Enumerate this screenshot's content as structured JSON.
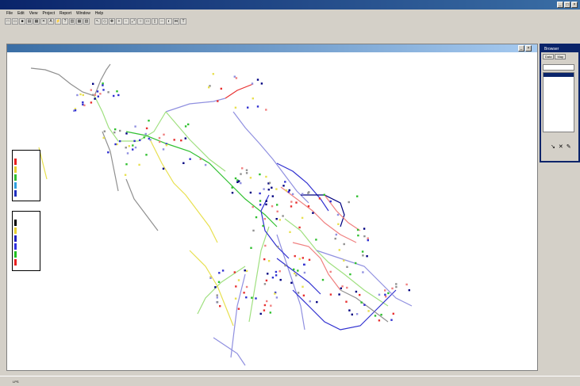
{
  "app": {
    "title": ""
  },
  "menu": {
    "items": [
      "File",
      "Edit",
      "View",
      "Project",
      "Report",
      "Window",
      "Help"
    ]
  },
  "toolbar": {
    "buttons": [
      {
        "name": "new",
        "glyph": "□"
      },
      {
        "name": "open",
        "glyph": "▭"
      },
      {
        "name": "save",
        "glyph": "■"
      },
      {
        "name": "print",
        "glyph": "▤"
      },
      {
        "name": "copy",
        "glyph": "▦"
      },
      {
        "name": "delete",
        "glyph": "✕"
      },
      {
        "name": "find",
        "glyph": "A"
      },
      {
        "name": "run",
        "glyph": "⚡"
      },
      {
        "name": "query",
        "glyph": "?"
      },
      {
        "name": "graph",
        "glyph": "▥"
      },
      {
        "name": "table",
        "glyph": "▦"
      },
      {
        "name": "options",
        "glyph": "▧"
      },
      {
        "name": "select",
        "glyph": "↖"
      },
      {
        "name": "vertex",
        "glyph": "◇"
      },
      {
        "name": "pan",
        "glyph": "✥"
      },
      {
        "name": "zoom-in",
        "glyph": "+"
      },
      {
        "name": "zoom-out",
        "glyph": "−"
      },
      {
        "name": "full-extent",
        "glyph": "⤢"
      },
      {
        "name": "junction",
        "glyph": "○"
      },
      {
        "name": "reservoir",
        "glyph": "▭"
      },
      {
        "name": "tank",
        "glyph": "▯"
      },
      {
        "name": "pipe",
        "glyph": "─"
      },
      {
        "name": "pump",
        "glyph": "◐"
      },
      {
        "name": "valve",
        "glyph": "⋈"
      },
      {
        "name": "label",
        "glyph": "T"
      }
    ]
  },
  "map": {
    "title": "",
    "colors": {
      "red": "#e83030",
      "pink": "#f08080",
      "green": "#30c030",
      "lightgreen": "#a0e080",
      "yellow": "#e8e050",
      "blue": "#3030d0",
      "lightblue": "#9090e0",
      "navy": "#000080",
      "grey": "#909090"
    }
  },
  "legend_nodes": {
    "title": "",
    "labels": [
      "",
      "",
      "",
      "",
      ""
    ],
    "colors": [
      "#e82020",
      "#e8d030",
      "#30c030",
      "#30a0e0",
      "#2030c0"
    ]
  },
  "legend_links": {
    "title": "",
    "labels": [
      "",
      "",
      "",
      "",
      "",
      ""
    ],
    "colors": [
      "#000000",
      "#e8d030",
      "#2020c0",
      "#3030e0",
      "#20c020",
      "#e82020"
    ]
  },
  "browser": {
    "title": "Browser",
    "tabs": [
      "Data",
      "Map"
    ],
    "selector": "",
    "items": [
      "",
      "",
      "",
      "",
      "",
      "",
      "",
      "",
      "",
      "",
      "",
      ""
    ]
  },
  "status": {
    "autolength": "",
    "units": "LPS",
    "zoom": "",
    "xy": ""
  }
}
